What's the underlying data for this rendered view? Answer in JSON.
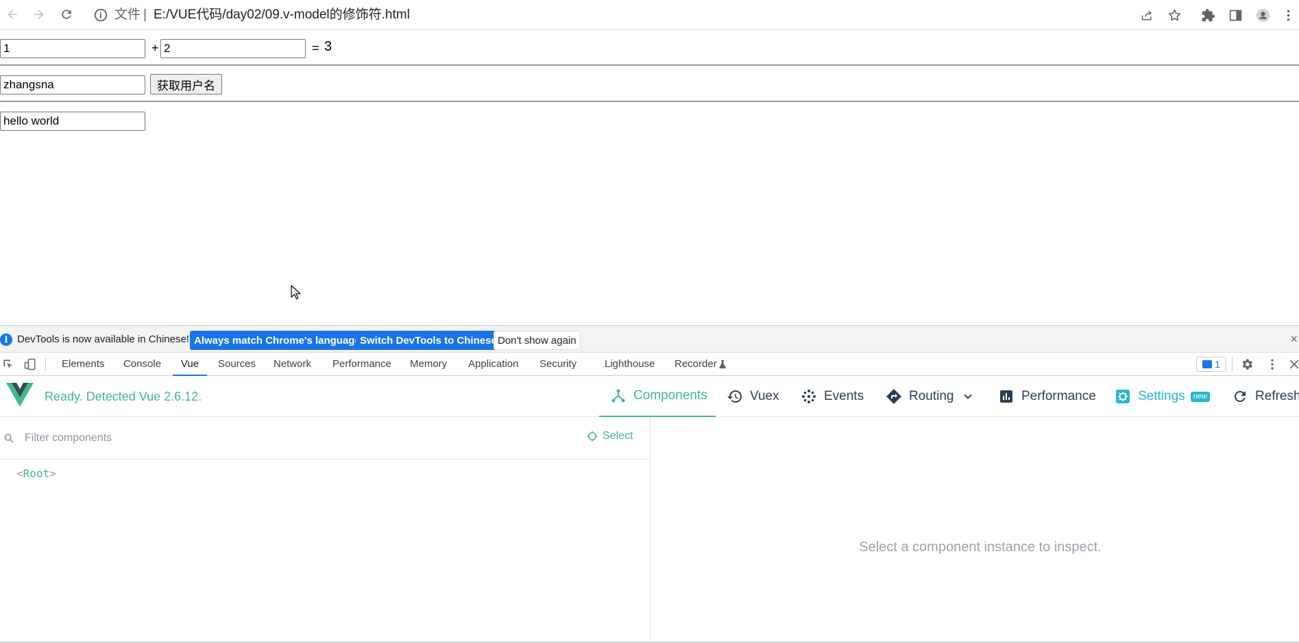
{
  "browser": {
    "url_scheme": "文件",
    "url_separator": "|",
    "url_path": "E:/VUE代码/day02/09.v-model的修饰符.html"
  },
  "page": {
    "sum": {
      "a": "1",
      "plus": "+",
      "b": "2",
      "equals": "=",
      "result": "3"
    },
    "username": {
      "value": "zhangsna",
      "button_label": "获取用户名"
    },
    "message": {
      "value": "hello world"
    }
  },
  "notice": {
    "message": "DevTools is now available in Chinese!",
    "btn_match": "Always match Chrome's language",
    "btn_switch": "Switch DevTools to Chinese",
    "btn_dismiss": "Don't show again",
    "close": "×"
  },
  "devtools": {
    "tabs": [
      "Elements",
      "Console",
      "Vue",
      "Sources",
      "Network",
      "Performance",
      "Memory",
      "Application",
      "Security",
      "Lighthouse",
      "Recorder"
    ],
    "active_tab": "Vue",
    "issues_count": "1"
  },
  "vue": {
    "status": "Ready. Detected Vue 2.6.12.",
    "tabs": {
      "components": "Components",
      "vuex": "Vuex",
      "events": "Events",
      "routing": "Routing",
      "performance": "Performance",
      "settings": "Settings",
      "settings_badge": "new",
      "refresh": "Refresh"
    },
    "filter_placeholder": "Filter components",
    "select_label": "Select",
    "tree": {
      "root_open": "<",
      "root_name": "Root",
      "root_close": ">"
    },
    "empty_message": "Select a component instance to inspect."
  },
  "colors": {
    "vue_green": "#42b983",
    "settings_cyan": "#22b8cf",
    "chrome_blue": "#1a73e8"
  }
}
